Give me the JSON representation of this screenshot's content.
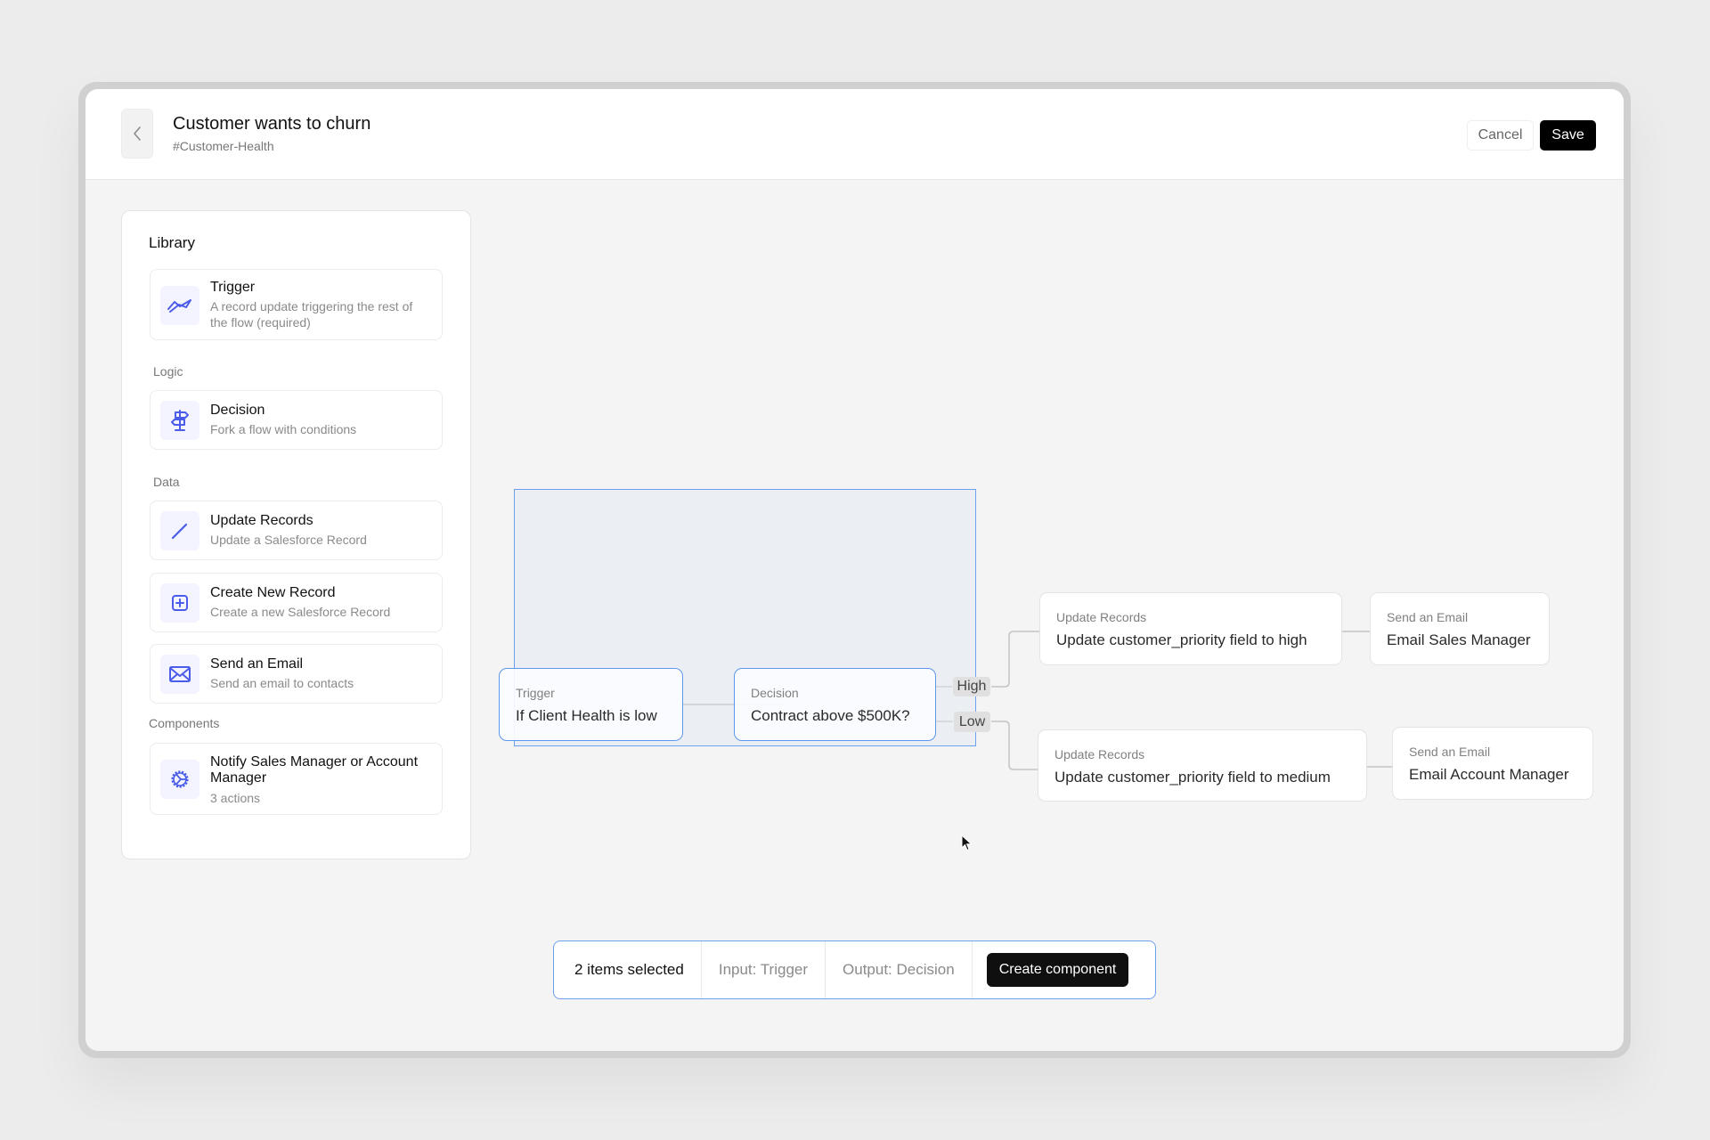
{
  "header": {
    "title": "Customer wants to churn",
    "subtitle": "#Customer-Health",
    "back_icon": "chevron-left-icon",
    "cancel_label": "Cancel",
    "save_label": "Save"
  },
  "library": {
    "title": "Library",
    "trigger": {
      "name": "Trigger",
      "description": "A record update triggering the rest of the flow (required)",
      "icon": "trigger-wave-icon"
    },
    "sections": {
      "logic": "Logic",
      "data": "Data",
      "components": "Components"
    },
    "logic_items": [
      {
        "name": "Decision",
        "description": "Fork a flow with conditions",
        "icon": "signpost-icon"
      }
    ],
    "data_items": [
      {
        "name": "Update Records",
        "description": "Update a Salesforce Record",
        "icon": "pencil-icon"
      },
      {
        "name": "Create New Record",
        "description": "Create a new Salesforce Record",
        "icon": "plus-square-icon"
      },
      {
        "name": "Send an Email",
        "description": "Send an email to contacts",
        "icon": "envelope-icon"
      }
    ],
    "component_items": [
      {
        "name": "Notify Sales Manager or Account Manager",
        "description": "3 actions",
        "icon": "gear-icon"
      }
    ]
  },
  "canvas": {
    "nodes": {
      "trigger": {
        "type": "Trigger",
        "label": "If Client Health is low",
        "selected": true
      },
      "decision": {
        "type": "Decision",
        "label": "Contract above $500K?",
        "selected": true
      },
      "update_high": {
        "type": "Update Records",
        "label": "Update customer_priority field to high"
      },
      "email_sales": {
        "type": "Send an Email",
        "label": "Email Sales Manager"
      },
      "update_medium": {
        "type": "Update Records",
        "label": "Update customer_priority field to medium"
      },
      "email_account": {
        "type": "Send an Email",
        "label": "Email Account Manager"
      }
    },
    "branches": {
      "high": "High",
      "low": "Low"
    }
  },
  "selection_bar": {
    "count_label": "2 items selected",
    "input_label": "Input: Trigger",
    "output_label": "Output: Decision",
    "create_label": "Create component"
  },
  "colors": {
    "accent": "#4a5ce8",
    "selection": "#5f97ee",
    "primary_button": "#000000"
  }
}
